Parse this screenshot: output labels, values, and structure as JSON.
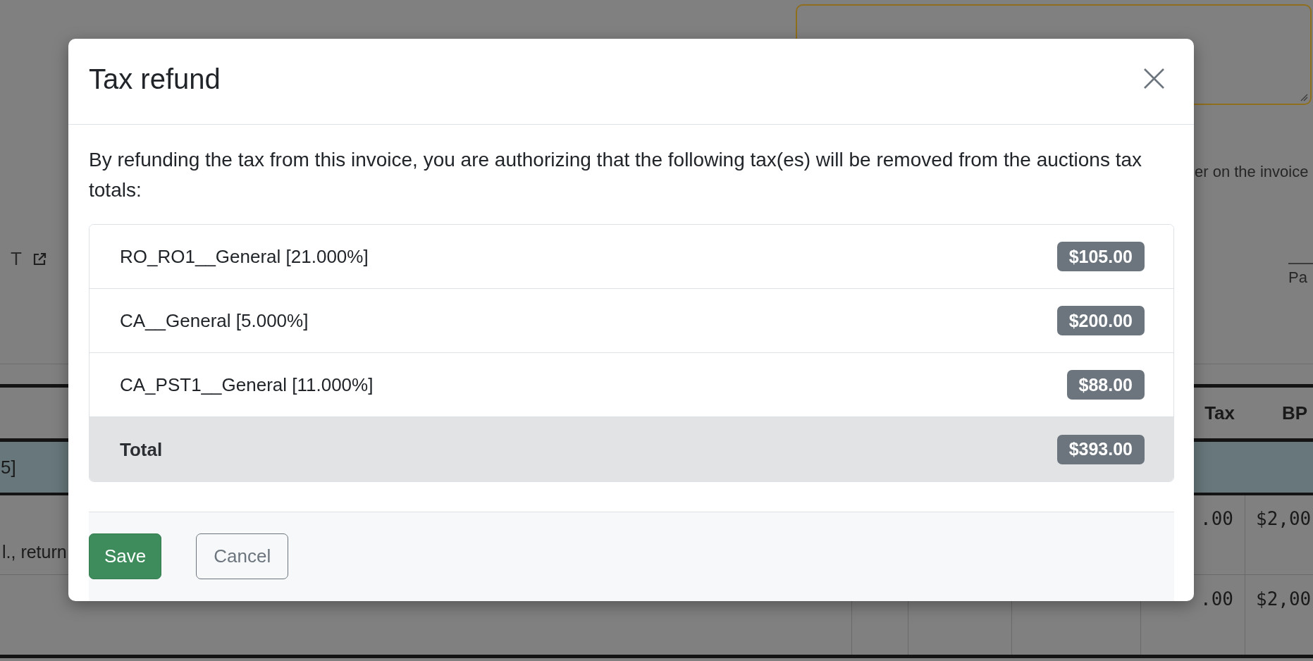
{
  "page": {
    "link": {
      "label": "T"
    },
    "notice": "er on the invoice",
    "payment_label": "Pa",
    "table": {
      "columns": [
        "Tax",
        "BP"
      ],
      "group_label": "5]",
      "rows": [
        {
          "description": "l., return",
          "cells": [
            ".00",
            "$2,00"
          ]
        },
        {
          "cells": [
            ".00",
            "$2,00"
          ]
        }
      ]
    }
  },
  "modal": {
    "title": "Tax refund",
    "message": "By refunding the tax from this invoice, you are authorizing that the following tax(es) will be removed from the auctions tax totals:",
    "taxes": [
      {
        "name": "RO_RO1__General [21.000%]",
        "amount": "$105.00"
      },
      {
        "name": "CA__General [5.000%]",
        "amount": "$200.00"
      },
      {
        "name": "CA_PST1__General [11.000%]",
        "amount": "$88.00"
      }
    ],
    "total": {
      "label": "Total",
      "amount": "$393.00"
    },
    "buttons": [
      {
        "label": "Save",
        "kind": "primary"
      },
      {
        "label": "Cancel",
        "kind": "secondary"
      }
    ]
  }
}
